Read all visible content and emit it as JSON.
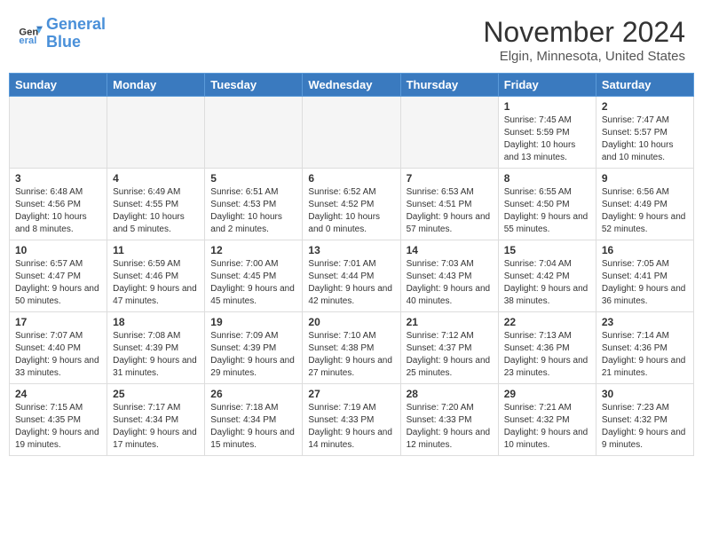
{
  "logo": {
    "text_general": "General",
    "text_blue": "Blue"
  },
  "title": "November 2024",
  "subtitle": "Elgin, Minnesota, United States",
  "days_of_week": [
    "Sunday",
    "Monday",
    "Tuesday",
    "Wednesday",
    "Thursday",
    "Friday",
    "Saturday"
  ],
  "weeks": [
    [
      {
        "day": "",
        "info": ""
      },
      {
        "day": "",
        "info": ""
      },
      {
        "day": "",
        "info": ""
      },
      {
        "day": "",
        "info": ""
      },
      {
        "day": "",
        "info": ""
      },
      {
        "day": "1",
        "info": "Sunrise: 7:45 AM\nSunset: 5:59 PM\nDaylight: 10 hours and 13 minutes."
      },
      {
        "day": "2",
        "info": "Sunrise: 7:47 AM\nSunset: 5:57 PM\nDaylight: 10 hours and 10 minutes."
      }
    ],
    [
      {
        "day": "3",
        "info": "Sunrise: 6:48 AM\nSunset: 4:56 PM\nDaylight: 10 hours and 8 minutes."
      },
      {
        "day": "4",
        "info": "Sunrise: 6:49 AM\nSunset: 4:55 PM\nDaylight: 10 hours and 5 minutes."
      },
      {
        "day": "5",
        "info": "Sunrise: 6:51 AM\nSunset: 4:53 PM\nDaylight: 10 hours and 2 minutes."
      },
      {
        "day": "6",
        "info": "Sunrise: 6:52 AM\nSunset: 4:52 PM\nDaylight: 10 hours and 0 minutes."
      },
      {
        "day": "7",
        "info": "Sunrise: 6:53 AM\nSunset: 4:51 PM\nDaylight: 9 hours and 57 minutes."
      },
      {
        "day": "8",
        "info": "Sunrise: 6:55 AM\nSunset: 4:50 PM\nDaylight: 9 hours and 55 minutes."
      },
      {
        "day": "9",
        "info": "Sunrise: 6:56 AM\nSunset: 4:49 PM\nDaylight: 9 hours and 52 minutes."
      }
    ],
    [
      {
        "day": "10",
        "info": "Sunrise: 6:57 AM\nSunset: 4:47 PM\nDaylight: 9 hours and 50 minutes."
      },
      {
        "day": "11",
        "info": "Sunrise: 6:59 AM\nSunset: 4:46 PM\nDaylight: 9 hours and 47 minutes."
      },
      {
        "day": "12",
        "info": "Sunrise: 7:00 AM\nSunset: 4:45 PM\nDaylight: 9 hours and 45 minutes."
      },
      {
        "day": "13",
        "info": "Sunrise: 7:01 AM\nSunset: 4:44 PM\nDaylight: 9 hours and 42 minutes."
      },
      {
        "day": "14",
        "info": "Sunrise: 7:03 AM\nSunset: 4:43 PM\nDaylight: 9 hours and 40 minutes."
      },
      {
        "day": "15",
        "info": "Sunrise: 7:04 AM\nSunset: 4:42 PM\nDaylight: 9 hours and 38 minutes."
      },
      {
        "day": "16",
        "info": "Sunrise: 7:05 AM\nSunset: 4:41 PM\nDaylight: 9 hours and 36 minutes."
      }
    ],
    [
      {
        "day": "17",
        "info": "Sunrise: 7:07 AM\nSunset: 4:40 PM\nDaylight: 9 hours and 33 minutes."
      },
      {
        "day": "18",
        "info": "Sunrise: 7:08 AM\nSunset: 4:39 PM\nDaylight: 9 hours and 31 minutes."
      },
      {
        "day": "19",
        "info": "Sunrise: 7:09 AM\nSunset: 4:39 PM\nDaylight: 9 hours and 29 minutes."
      },
      {
        "day": "20",
        "info": "Sunrise: 7:10 AM\nSunset: 4:38 PM\nDaylight: 9 hours and 27 minutes."
      },
      {
        "day": "21",
        "info": "Sunrise: 7:12 AM\nSunset: 4:37 PM\nDaylight: 9 hours and 25 minutes."
      },
      {
        "day": "22",
        "info": "Sunrise: 7:13 AM\nSunset: 4:36 PM\nDaylight: 9 hours and 23 minutes."
      },
      {
        "day": "23",
        "info": "Sunrise: 7:14 AM\nSunset: 4:36 PM\nDaylight: 9 hours and 21 minutes."
      }
    ],
    [
      {
        "day": "24",
        "info": "Sunrise: 7:15 AM\nSunset: 4:35 PM\nDaylight: 9 hours and 19 minutes."
      },
      {
        "day": "25",
        "info": "Sunrise: 7:17 AM\nSunset: 4:34 PM\nDaylight: 9 hours and 17 minutes."
      },
      {
        "day": "26",
        "info": "Sunrise: 7:18 AM\nSunset: 4:34 PM\nDaylight: 9 hours and 15 minutes."
      },
      {
        "day": "27",
        "info": "Sunrise: 7:19 AM\nSunset: 4:33 PM\nDaylight: 9 hours and 14 minutes."
      },
      {
        "day": "28",
        "info": "Sunrise: 7:20 AM\nSunset: 4:33 PM\nDaylight: 9 hours and 12 minutes."
      },
      {
        "day": "29",
        "info": "Sunrise: 7:21 AM\nSunset: 4:32 PM\nDaylight: 9 hours and 10 minutes."
      },
      {
        "day": "30",
        "info": "Sunrise: 7:23 AM\nSunset: 4:32 PM\nDaylight: 9 hours and 9 minutes."
      }
    ]
  ]
}
